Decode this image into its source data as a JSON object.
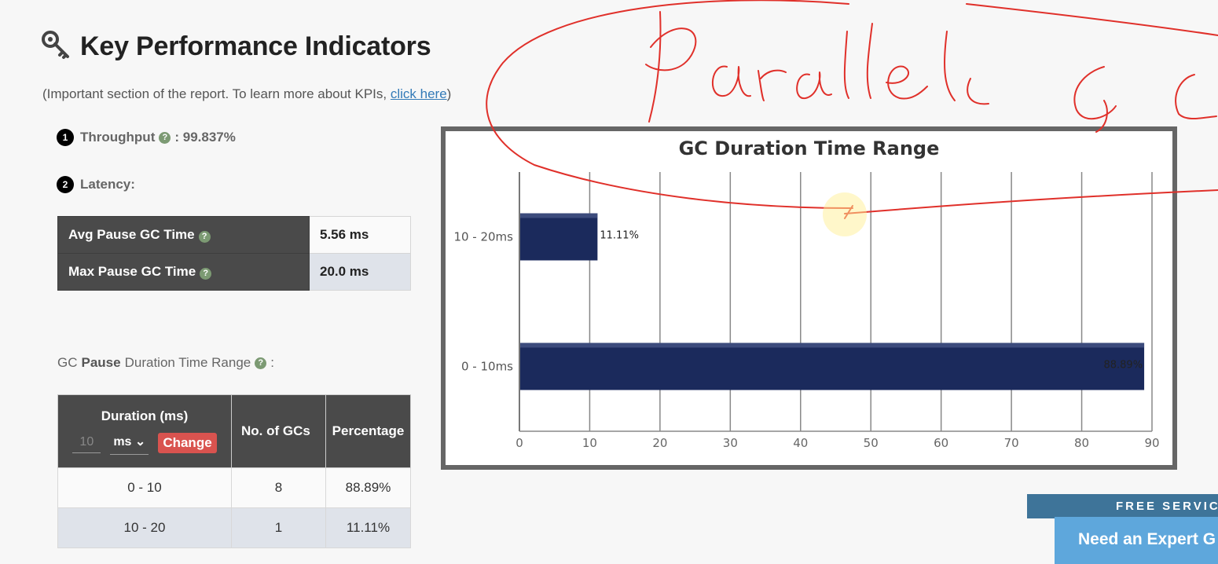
{
  "header": {
    "title": "Key Performance Indicators",
    "subtitle_prefix": "(Important section of the report. To learn more about KPIs, ",
    "subtitle_link": "click here",
    "subtitle_suffix": ")"
  },
  "kpis": {
    "throughput_num": "1",
    "throughput_label": "Throughput",
    "throughput_value": ": 99.837%",
    "latency_num": "2",
    "latency_label": "Latency:"
  },
  "latency_table": {
    "rows": [
      {
        "label": "Avg Pause GC Time",
        "value": "5.56 ms"
      },
      {
        "label": "Max Pause GC Time",
        "value": "20.0 ms"
      }
    ]
  },
  "range_caption": {
    "pre": "GC",
    "bold": "Pause",
    "post": "Duration Time Range",
    "colon": ":"
  },
  "range_table": {
    "duration_header": "Duration (ms)",
    "duration_input_value": "10",
    "unit_selected": "ms",
    "change_label": "Change",
    "gcs_header": "No. of GCs",
    "percentage_header": "Percentage",
    "rows": [
      {
        "range": "0 - 10",
        "count": "8",
        "pct": "88.89%"
      },
      {
        "range": "10 - 20",
        "count": "1",
        "pct": "11.11%"
      }
    ]
  },
  "chart_data": {
    "type": "bar",
    "orientation": "horizontal",
    "title": "GC Duration Time Range",
    "categories": [
      "10 - 20ms",
      "0 - 10ms"
    ],
    "values": [
      11.11,
      88.89
    ],
    "data_labels": [
      "11.11%",
      "88.89%"
    ],
    "xlim": [
      0,
      90
    ],
    "xticks": [
      0,
      10,
      20,
      30,
      40,
      50,
      60,
      70,
      80,
      90
    ],
    "grid": true,
    "bar_color": "#1b2a5c"
  },
  "banners": {
    "free_services": "FREE SERVIC",
    "expert": "Need an Expert G"
  },
  "annotation": {
    "color": "#e0302a",
    "text": "Parallel GC"
  }
}
